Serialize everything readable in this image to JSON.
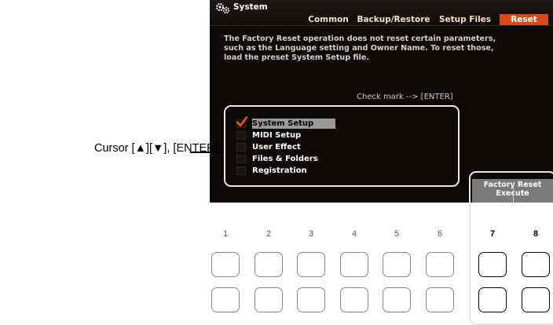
{
  "screen": {
    "title": "System",
    "tabs": [
      {
        "label": "Common",
        "active": false
      },
      {
        "label": "Backup/Restore",
        "active": false
      },
      {
        "label": "Setup Files",
        "active": false
      },
      {
        "label": "Reset",
        "active": true
      }
    ],
    "description": "The Factory Reset operation does not reset certain parameters,\nsuch as the Language setting and Owner Name. To reset those,\nload the preset System Setup file.",
    "hint": "Check mark --> [ENTER]",
    "items": [
      {
        "label": "System Setup",
        "checked": true,
        "selected": true
      },
      {
        "label": "MIDI Setup",
        "checked": false,
        "selected": false
      },
      {
        "label": "User Effect",
        "checked": false,
        "selected": false
      },
      {
        "label": "Files & Folders",
        "checked": false,
        "selected": false
      },
      {
        "label": "Registration",
        "checked": false,
        "selected": false
      }
    ]
  },
  "callout": "Cursor [▲][▼], [ENTER]",
  "factory_reset": {
    "line1": "Factory Reset",
    "line2": "Execute"
  },
  "panel": {
    "numbers": [
      "1",
      "2",
      "3",
      "4",
      "5",
      "6",
      "7",
      "8"
    ],
    "highlighted": [
      "7",
      "8"
    ]
  },
  "icons": {
    "system": "gears-icon",
    "check": "check-mark-icon"
  },
  "colors": {
    "accent_tab": "#d84a1c",
    "screen_bg": "#0d0a08",
    "check": "#e8542a"
  }
}
